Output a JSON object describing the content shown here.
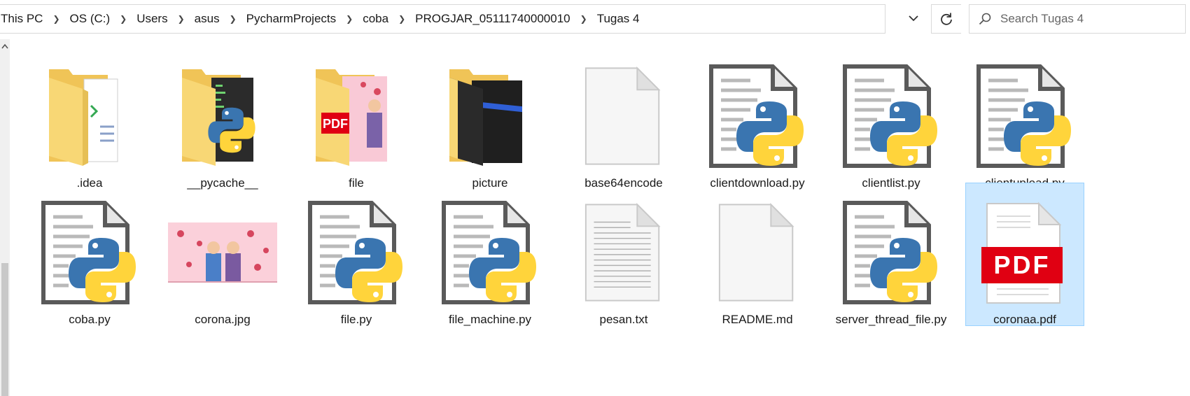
{
  "breadcrumb": [
    "This PC",
    "OS (C:)",
    "Users",
    "asus",
    "PycharmProjects",
    "coba",
    "PROGJAR_05111740000010",
    "Tugas 4"
  ],
  "search": {
    "placeholder": "Search Tugas 4"
  },
  "files": [
    {
      "name": ".idea",
      "icon": "folder-icon"
    },
    {
      "name": "__pycache__",
      "icon": "folder-icon"
    },
    {
      "name": "file",
      "icon": "folder-icon"
    },
    {
      "name": "picture",
      "icon": "folder-icon"
    },
    {
      "name": "base64encode",
      "icon": "file-icon"
    },
    {
      "name": "clientdownload.py",
      "icon": "python-file-icon"
    },
    {
      "name": "clientlist.py",
      "icon": "python-file-icon"
    },
    {
      "name": "clientupload.py",
      "icon": "python-file-icon"
    },
    {
      "name": "coba.py",
      "icon": "python-file-icon"
    },
    {
      "name": "corona.jpg",
      "icon": "image-thumbnail"
    },
    {
      "name": "file.py",
      "icon": "python-file-icon"
    },
    {
      "name": "file_machine.py",
      "icon": "python-file-icon"
    },
    {
      "name": "pesan.txt",
      "icon": "text-file-icon"
    },
    {
      "name": "README.md",
      "icon": "file-icon"
    },
    {
      "name": "server_thread_file.py",
      "icon": "python-file-icon"
    },
    {
      "name": "coronaa.pdf",
      "icon": "pdf-file-icon",
      "selected": true
    }
  ],
  "colors": {
    "selection_bg": "#cce8ff",
    "selection_border": "#99d1ff",
    "folder": "#f8d775",
    "python_blue": "#3a75b0",
    "python_yellow": "#ffd43b",
    "pdf_red": "#e00012"
  }
}
